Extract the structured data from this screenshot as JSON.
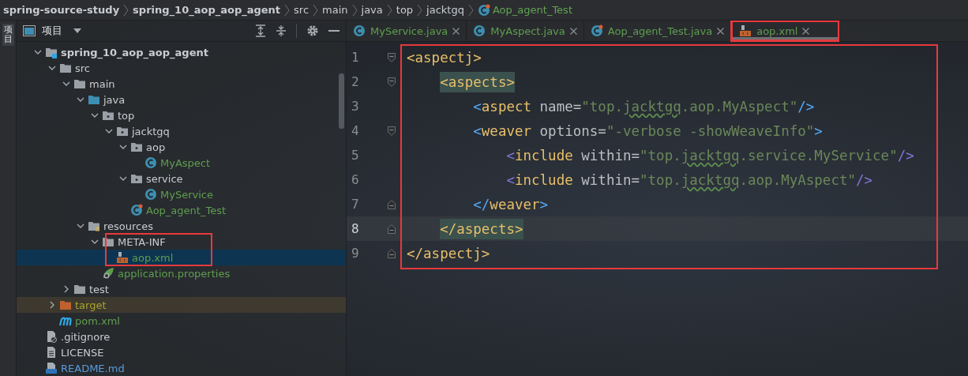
{
  "breadcrumb": [
    {
      "label": "spring-source-study",
      "kind": "project"
    },
    {
      "label": "spring_10_aop_aop_agent",
      "kind": "project"
    },
    {
      "label": "src",
      "kind": "folder"
    },
    {
      "label": "main",
      "kind": "folder"
    },
    {
      "label": "java",
      "kind": "folder"
    },
    {
      "label": "top",
      "kind": "folder"
    },
    {
      "label": "jacktgq",
      "kind": "folder"
    },
    {
      "label": "Aop_agent_Test",
      "kind": "test-class"
    }
  ],
  "side_strip": {
    "label": "项目"
  },
  "project_panel": {
    "title": "项目",
    "tree": [
      {
        "label": "spring_10_aop_aop_agent",
        "kind": "module",
        "color": "#c9ccd0",
        "expanded": true,
        "selected": false,
        "children": [
          {
            "label": "src",
            "kind": "folder",
            "color": "#c9ccd0",
            "expanded": true,
            "selected": false,
            "children": [
              {
                "label": "main",
                "kind": "folder",
                "color": "#c9ccd0",
                "expanded": true,
                "selected": false,
                "children": [
                  {
                    "label": "java",
                    "kind": "source",
                    "color": "#c9ccd0",
                    "expanded": true,
                    "selected": false,
                    "children": [
                      {
                        "label": "top",
                        "kind": "package",
                        "color": "#c9ccd0",
                        "expanded": true,
                        "selected": false,
                        "children": [
                          {
                            "label": "jacktgq",
                            "kind": "package",
                            "color": "#c9ccd0",
                            "expanded": true,
                            "selected": false,
                            "children": [
                              {
                                "label": "aop",
                                "kind": "package",
                                "color": "#c9ccd0",
                                "expanded": true,
                                "selected": false,
                                "children": [
                                  {
                                    "label": "MyAspect",
                                    "kind": "class",
                                    "color": "#5f9e4f",
                                    "selected": false
                                  }
                                ]
                              },
                              {
                                "label": "service",
                                "kind": "package",
                                "color": "#c9ccd0",
                                "expanded": true,
                                "selected": false,
                                "children": [
                                  {
                                    "label": "MyService",
                                    "kind": "class",
                                    "color": "#5f9e4f",
                                    "selected": false
                                  }
                                ]
                              },
                              {
                                "label": "Aop_agent_Test",
                                "kind": "test-class",
                                "color": "#5f9e4f",
                                "selected": false
                              }
                            ]
                          }
                        ]
                      }
                    ]
                  },
                  {
                    "label": "resources",
                    "kind": "resources",
                    "color": "#c9ccd0",
                    "expanded": true,
                    "selected": false,
                    "children": [
                      {
                        "label": "META-INF",
                        "kind": "folder",
                        "color": "#c9ccd0",
                        "expanded": true,
                        "selected": false,
                        "annotated": true,
                        "children": [
                          {
                            "label": "aop.xml",
                            "kind": "xml",
                            "color": "#5f9e4f",
                            "selected": true
                          }
                        ]
                      },
                      {
                        "label": "application.properties",
                        "kind": "spring",
                        "color": "#5f9e4f",
                        "selected": false
                      }
                    ]
                  }
                ]
              },
              {
                "label": "test",
                "kind": "folder",
                "color": "#c9ccd0",
                "expanded": false,
                "selected": false
              }
            ]
          },
          {
            "label": "target",
            "kind": "excluded",
            "color": "#a9a230",
            "expanded": false,
            "selected": false
          },
          {
            "label": "pom.xml",
            "kind": "maven",
            "color": "#5f9e4f",
            "selected": false
          }
        ]
      },
      {
        "label": ".gitignore",
        "kind": "gitignore",
        "color": "#c9ccd0",
        "selected": false
      },
      {
        "label": "LICENSE",
        "kind": "text",
        "color": "#c9ccd0",
        "selected": false
      },
      {
        "label": "README.md",
        "kind": "markdown",
        "color": "#5a9ad9",
        "selected": false
      }
    ]
  },
  "editor": {
    "annotated": true,
    "tabs": [
      {
        "label": "MyService.java",
        "kind": "class",
        "selected": false
      },
      {
        "label": "MyAspect.java",
        "kind": "class",
        "selected": false
      },
      {
        "label": "Aop_agent_Test.java",
        "kind": "test-class",
        "selected": false
      },
      {
        "label": "aop.xml",
        "kind": "xml",
        "selected": true,
        "annotated": true
      }
    ],
    "lines": [
      {
        "number": "1",
        "kind": "fold-start",
        "current": false,
        "tokens": [
          {
            "text": "<aspectj>",
            "kind": "tag"
          }
        ],
        "children": [
          {
            "number": "2",
            "kind": "fold-start",
            "current": false,
            "tokens": [
              {
                "text": "<aspects>",
                "kind": "match"
              }
            ],
            "children": [
              {
                "number": "3",
                "kind": "plain",
                "current": false,
                "tokens": [
                  {
                    "text": "<",
                    "kind": "brace"
                  },
                  {
                    "text": "aspect",
                    "kind": "tag"
                  },
                  {
                    "text": " name",
                    "kind": "attr"
                  },
                  {
                    "text": "=",
                    "kind": "plain"
                  },
                  {
                    "text": "\"top.",
                    "kind": "value"
                  },
                  {
                    "text": "jacktgq",
                    "kind": "typo"
                  },
                  {
                    "text": ".aop.MyAspect\"",
                    "kind": "value"
                  },
                  {
                    "text": "/>",
                    "kind": "brace"
                  }
                ]
              },
              {
                "number": "4",
                "kind": "fold-start",
                "current": false,
                "tokens": [
                  {
                    "text": "<",
                    "kind": "brace"
                  },
                  {
                    "text": "weaver",
                    "kind": "tag"
                  },
                  {
                    "text": " options",
                    "kind": "attr"
                  },
                  {
                    "text": "=",
                    "kind": "plain"
                  },
                  {
                    "text": "\"-verbose -showWeaveInfo\"",
                    "kind": "value"
                  },
                  {
                    "text": ">",
                    "kind": "brace"
                  }
                ],
                "children": [
                  {
                    "number": "5",
                    "kind": "plain",
                    "current": false,
                    "tokens": [
                      {
                        "text": "<",
                        "kind": "brace2"
                      },
                      {
                        "text": "include",
                        "kind": "tag"
                      },
                      {
                        "text": " within",
                        "kind": "attr"
                      },
                      {
                        "text": "=",
                        "kind": "plain"
                      },
                      {
                        "text": "\"top.",
                        "kind": "value"
                      },
                      {
                        "text": "jacktgq",
                        "kind": "typo"
                      },
                      {
                        "text": ".service.MyService\"",
                        "kind": "value"
                      },
                      {
                        "text": "/>",
                        "kind": "brace2"
                      }
                    ]
                  },
                  {
                    "number": "6",
                    "kind": "plain",
                    "current": false,
                    "tokens": [
                      {
                        "text": "<",
                        "kind": "brace2"
                      },
                      {
                        "text": "include",
                        "kind": "tag"
                      },
                      {
                        "text": " within",
                        "kind": "attr"
                      },
                      {
                        "text": "=",
                        "kind": "plain"
                      },
                      {
                        "text": "\"top.",
                        "kind": "value"
                      },
                      {
                        "text": "jacktgq",
                        "kind": "typo"
                      },
                      {
                        "text": ".aop.MyAspect\"",
                        "kind": "value"
                      },
                      {
                        "text": "/>",
                        "kind": "brace2"
                      }
                    ]
                  }
                ]
              },
              {
                "number": "7",
                "kind": "fold-end",
                "current": false,
                "tokens": [
                  {
                    "text": "</",
                    "kind": "brace"
                  },
                  {
                    "text": "weaver",
                    "kind": "tag"
                  },
                  {
                    "text": ">",
                    "kind": "brace"
                  }
                ]
              }
            ]
          },
          {
            "number": "8",
            "kind": "fold-end",
            "current": true,
            "tokens": [
              {
                "text": "</aspects>",
                "kind": "match"
              }
            ]
          }
        ]
      },
      {
        "number": "9",
        "kind": "fold-end",
        "current": false,
        "tokens": [
          {
            "text": "</aspectj>",
            "kind": "tag"
          }
        ]
      }
    ]
  }
}
